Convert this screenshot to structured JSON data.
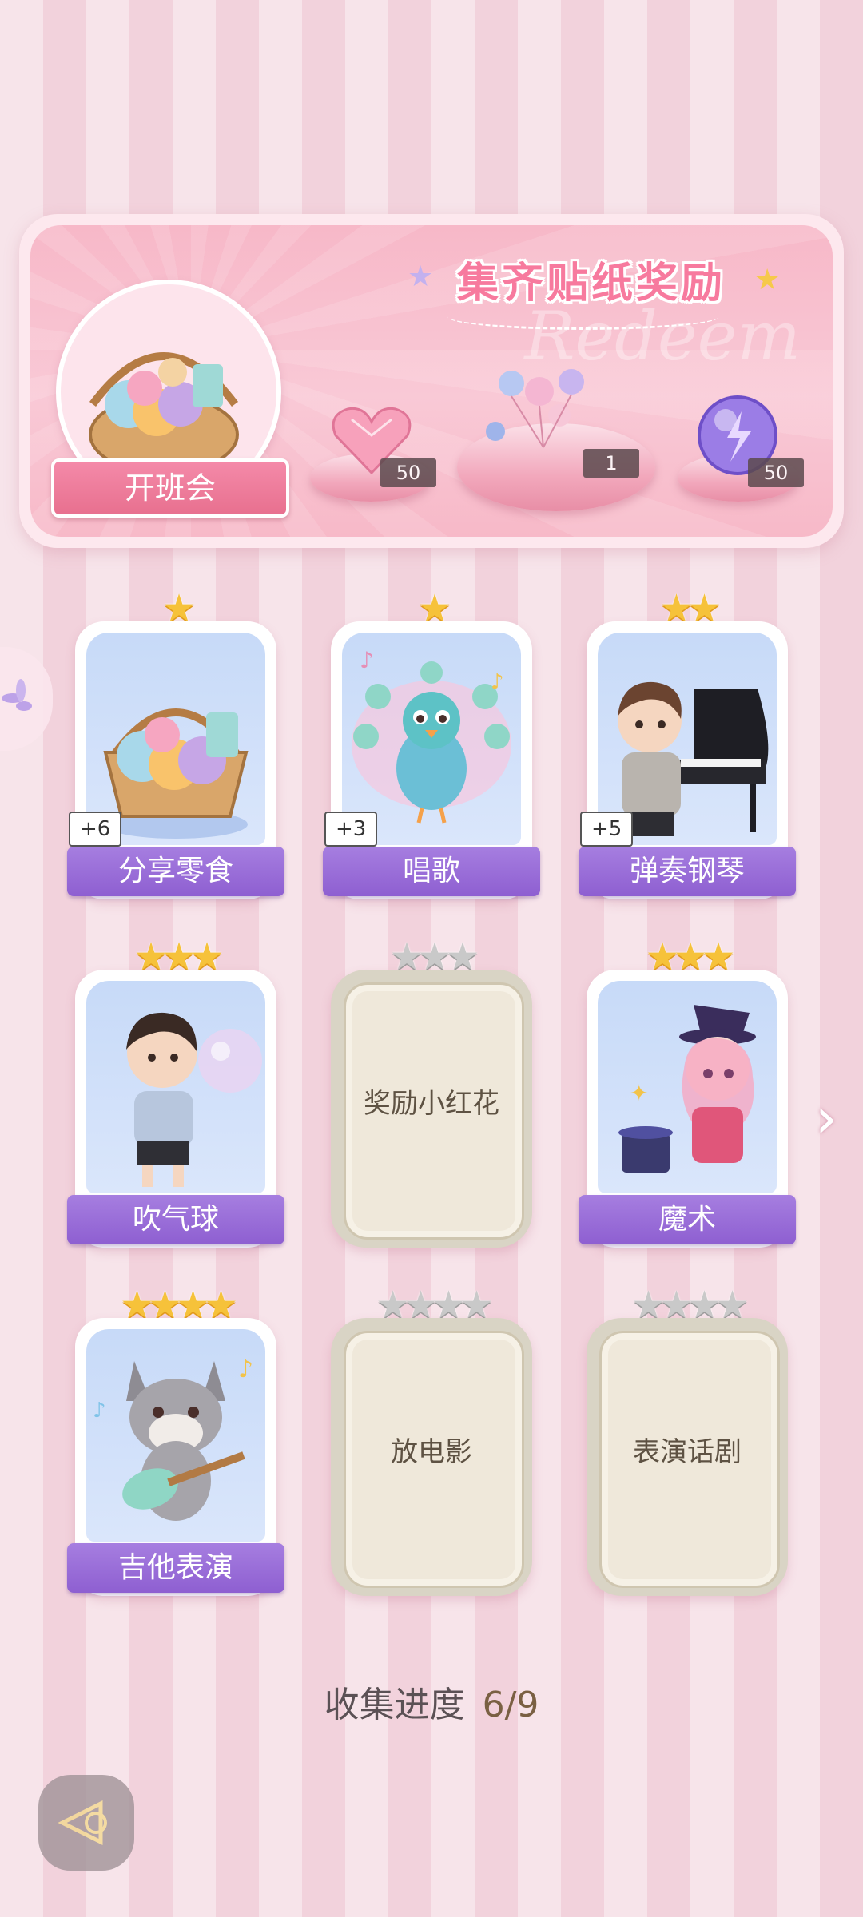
{
  "banner": {
    "title": "集齐贴纸奖励",
    "watermark": "Redeem",
    "event_label": "开班会",
    "rewards": [
      {
        "icon": "pink-heart-gem-icon",
        "count": "50"
      },
      {
        "icon": "balloon-bundle-icon",
        "count": "1"
      },
      {
        "icon": "purple-energy-orb-icon",
        "count": "50"
      }
    ]
  },
  "cards": [
    {
      "name": "分享零食",
      "stars": 1,
      "max_stars": 1,
      "bonus": "+6",
      "locked": false,
      "art": "snack-basket-icon"
    },
    {
      "name": "唱歌",
      "stars": 1,
      "max_stars": 1,
      "bonus": "+3",
      "locked": false,
      "art": "singing-peacock-icon"
    },
    {
      "name": "弹奏钢琴",
      "stars": 2,
      "max_stars": 2,
      "bonus": "+5",
      "locked": false,
      "art": "piano-boy-icon"
    },
    {
      "name": "吹气球",
      "stars": 3,
      "max_stars": 3,
      "bonus": "",
      "locked": false,
      "art": "balloon-boy-icon"
    },
    {
      "name": "奖励小红花",
      "stars": 0,
      "max_stars": 3,
      "bonus": "",
      "locked": true,
      "art": ""
    },
    {
      "name": "魔术",
      "stars": 3,
      "max_stars": 3,
      "bonus": "",
      "locked": false,
      "art": "magician-girl-icon"
    },
    {
      "name": "吉他表演",
      "stars": 4,
      "max_stars": 4,
      "bonus": "",
      "locked": false,
      "art": "guitar-wolf-icon"
    },
    {
      "name": "放电影",
      "stars": 0,
      "max_stars": 4,
      "bonus": "",
      "locked": true,
      "art": ""
    },
    {
      "name": "表演话剧",
      "stars": 0,
      "max_stars": 4,
      "bonus": "",
      "locked": true,
      "art": ""
    }
  ],
  "progress": {
    "label": "收集进度",
    "value": "6/9"
  },
  "colors": {
    "accent_pink": "#f77a9e",
    "label_purple": "#9a6bd8",
    "star_gold": "#f6c23a"
  }
}
